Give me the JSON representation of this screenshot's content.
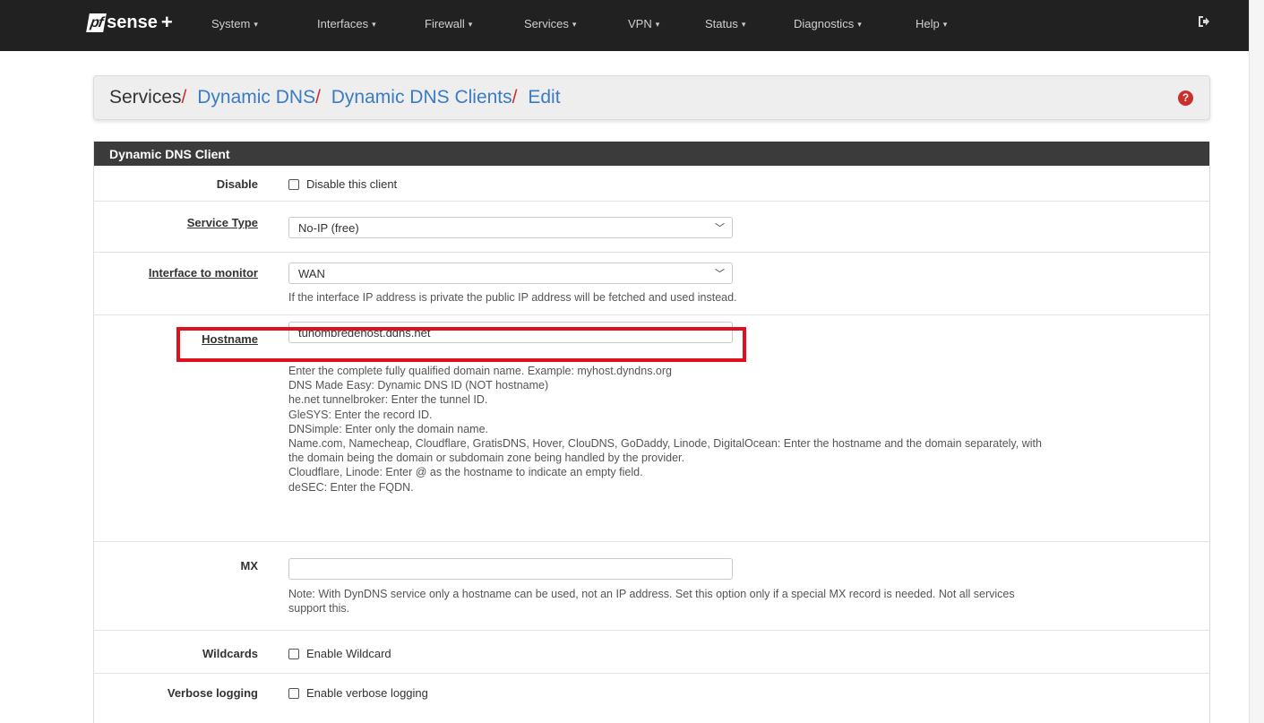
{
  "navbar": {
    "brand": {
      "pf": "pf",
      "sense": "sense",
      "plus": "+"
    },
    "menu": [
      {
        "label": "System"
      },
      {
        "label": "Interfaces"
      },
      {
        "label": "Firewall"
      },
      {
        "label": "Services"
      },
      {
        "label": "VPN"
      },
      {
        "label": "Status"
      },
      {
        "label": "Diagnostics"
      },
      {
        "label": "Help"
      }
    ],
    "caret": "▾",
    "logout_icon": "sign-out-icon"
  },
  "breadcrumb": {
    "items": [
      "Services",
      "Dynamic DNS",
      "Dynamic DNS Clients",
      "Edit"
    ],
    "separator": "/",
    "help": "?"
  },
  "panel": {
    "title": "Dynamic DNS Client",
    "disable": {
      "label": "Disable",
      "checkbox_label": "Disable this client",
      "checked": false
    },
    "service_type": {
      "label": "Service Type",
      "value": "No-IP (free)"
    },
    "interface": {
      "label": "Interface to monitor",
      "value": "WAN",
      "help": "If the interface IP address is private the public IP address will be fetched and used instead."
    },
    "hostname": {
      "label": "Hostname",
      "value": "tunombredehost.ddns.net",
      "help": [
        "Enter the complete fully qualified domain name. Example: myhost.dyndns.org",
        "DNS Made Easy: Dynamic DNS ID (NOT hostname)",
        "he.net tunnelbroker: Enter the tunnel ID.",
        "GleSYS: Enter the record ID.",
        "DNSimple: Enter only the domain name.",
        "Name.com, Namecheap, Cloudflare, GratisDNS, Hover, ClouDNS, GoDaddy, Linode, DigitalOcean: Enter the hostname and the domain separately, with",
        "the domain being the domain or subdomain zone being handled by the provider.",
        "Cloudflare, Linode: Enter @ as the hostname to indicate an empty field.",
        "deSEC: Enter the FQDN."
      ]
    },
    "mx": {
      "label": "MX",
      "value": "",
      "help": [
        "Note: With DynDNS service only a hostname can be used, not an IP address. Set this option only if a special MX record is needed. Not all services",
        "support this."
      ]
    },
    "wildcards": {
      "label": "Wildcards",
      "checkbox_label": "Enable Wildcard",
      "checked": false
    },
    "verbose": {
      "label": "Verbose logging",
      "checkbox_label": "Enable verbose logging",
      "checked": false
    }
  },
  "colors": {
    "navbar": "#212121",
    "panel_heading": "#3b3b3b",
    "link": "#3b7bc1",
    "separator": "#c9302c",
    "highlight": "#e0111f"
  }
}
